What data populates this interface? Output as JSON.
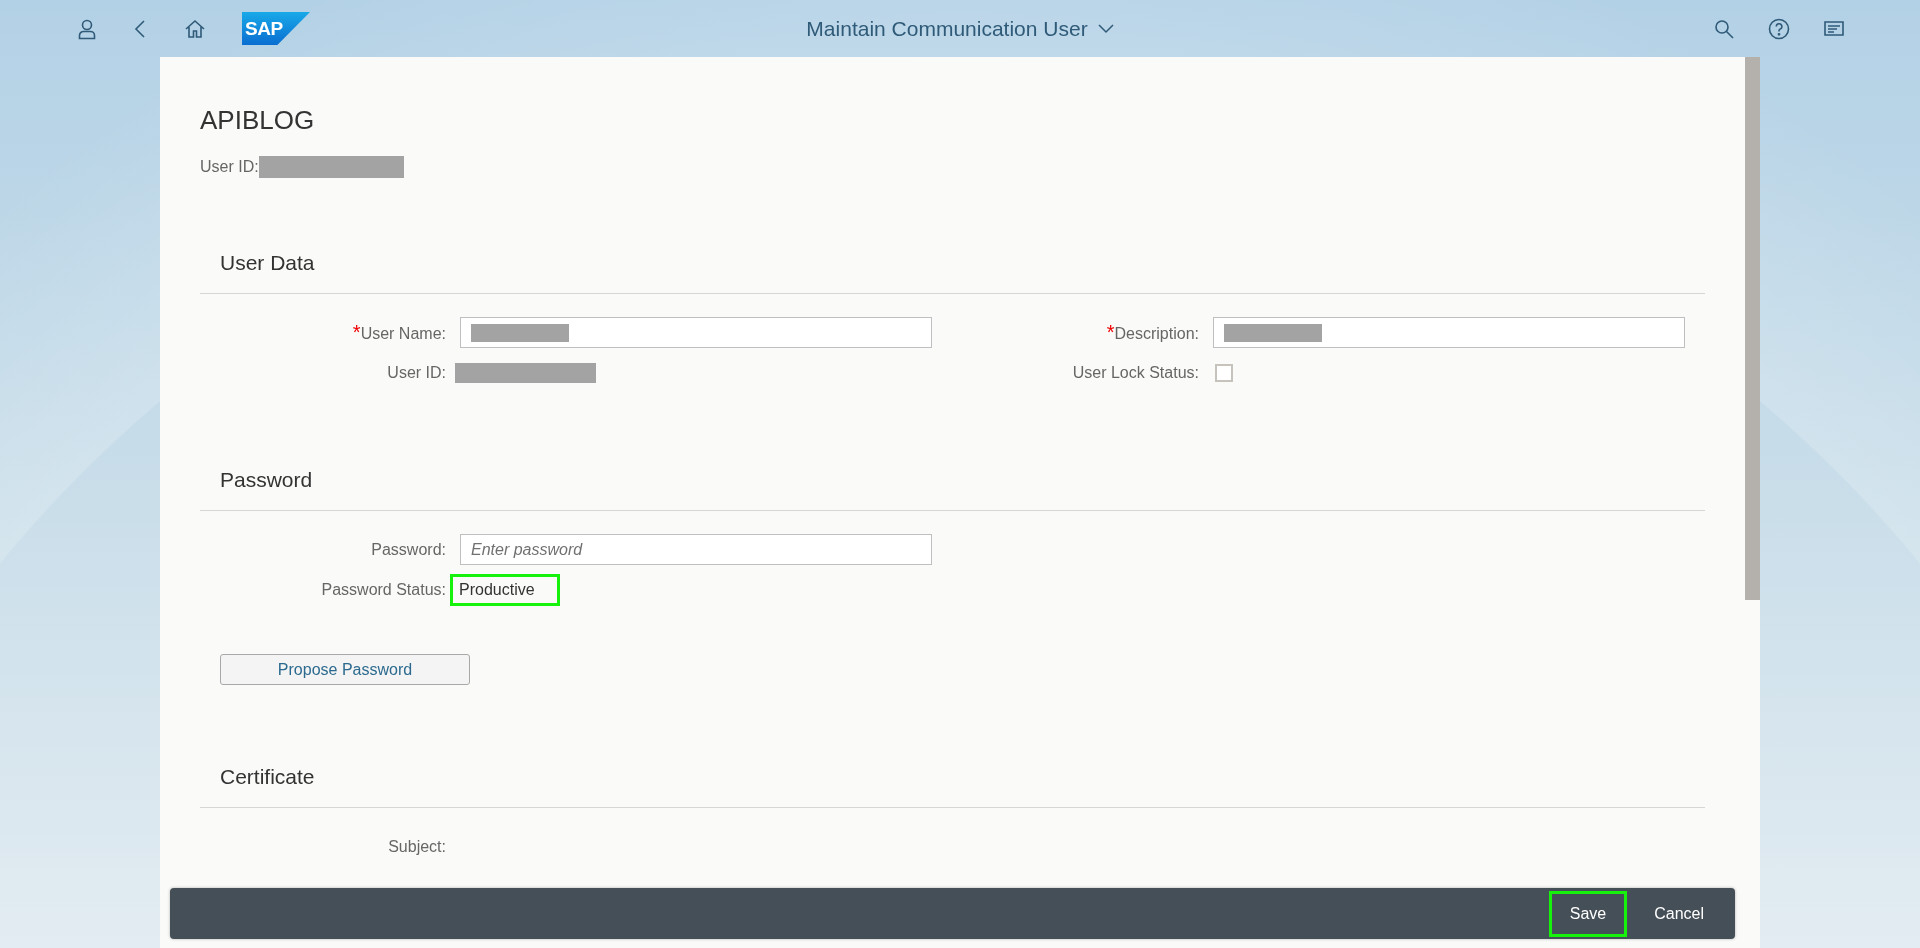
{
  "header": {
    "title": "Maintain Communication User",
    "logo": "SAP"
  },
  "page": {
    "title": "APIBLOG",
    "header_fields": [
      {
        "label": "User ID:",
        "redacted": true
      }
    ]
  },
  "sections": [
    {
      "title": "User Data",
      "columns": [
        [
          {
            "kind": "input",
            "required_mark": "*",
            "label": "User Name:",
            "redacted": true
          },
          {
            "kind": "text",
            "label": "User ID:",
            "redacted": true
          }
        ],
        [
          {
            "kind": "input",
            "required_mark": "*",
            "label": "Description:",
            "redacted": true
          },
          {
            "kind": "checkbox",
            "label": "User Lock Status:",
            "checked": false
          }
        ]
      ]
    },
    {
      "title": "Password",
      "columns": [
        [
          {
            "kind": "input",
            "label": "Password:",
            "placeholder": "Enter password"
          },
          {
            "kind": "text",
            "label": "Password Status:",
            "value": "Productive",
            "highlighted": true
          }
        ]
      ],
      "buttons": [
        "Propose Password"
      ]
    },
    {
      "title": "Certificate",
      "columns": [
        [
          {
            "kind": "text",
            "label": "Subject:"
          }
        ]
      ]
    }
  ],
  "footer": {
    "buttons": [
      {
        "label": "Save",
        "highlighted": true
      },
      {
        "label": "Cancel",
        "highlighted": false
      }
    ]
  }
}
